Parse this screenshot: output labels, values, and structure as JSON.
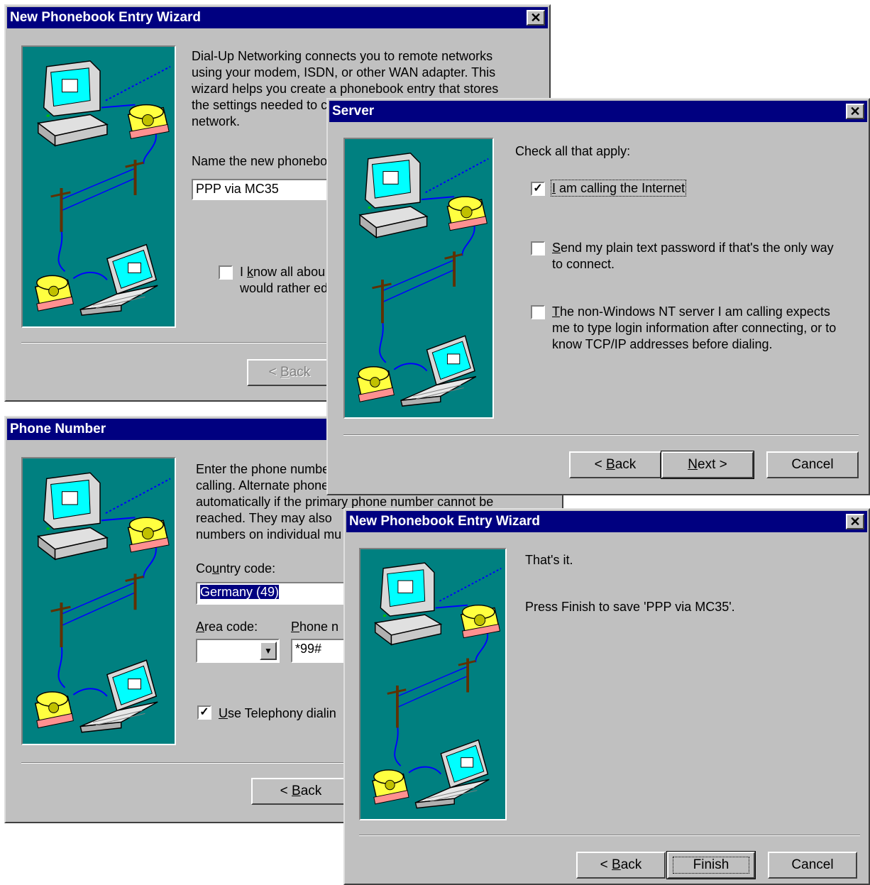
{
  "w1": {
    "title": "New Phonebook Entry Wizard",
    "intro": "Dial-Up Networking connects you to remote networks\nusing your modem, ISDN, or other WAN adapter.  This\nwizard helps you create a phonebook entry that stores\nthe settings needed to c\nnetwork.",
    "name_label": "Name the new phonebo",
    "name_value": "PPP via MC35",
    "know_pre": "I ",
    "know_u": "k",
    "know_post": "now all abou\nwould rather ed",
    "back_u": "B",
    "back_post": "ack",
    "back_pre": "< "
  },
  "w2": {
    "title": "Server",
    "check_label": "Check all that apply:",
    "opt1_u": "I",
    "opt1_rest": " am calling the Internet",
    "opt1_checked": true,
    "opt2_u": "S",
    "opt2_rest": "end my plain text password if that's the only way\nto connect.",
    "opt3_u": "T",
    "opt3_rest": "he non-Windows NT server I am calling expects\nme to type login information after connecting, or to\nknow TCP/IP addresses before dialing.",
    "back_pre": "< ",
    "back_u": "B",
    "back_post": "ack",
    "next_u": "N",
    "next_post": "ext >",
    "cancel": "Cancel"
  },
  "w3": {
    "title": "Phone Number",
    "intro": "Enter the phone number of the dial-up server you are\ncalling.  Alternate phone numbers, if any, are dialed\nautomatically if the primary phone number cannot be\nreached.  They may also\nnumbers on individual mu",
    "country_pre": "Co",
    "country_u": "u",
    "country_post": "ntry code:",
    "country_value": "Germany (49)",
    "area_pre": "",
    "area_u": "A",
    "area_post": "rea code:",
    "phone_u": "P",
    "phone_post": "hone n",
    "phone_value": "*99#",
    "telephony_u": "U",
    "telephony_post": "se Telephony dialin",
    "back_pre": "< ",
    "back_u": "B",
    "back_post": "ack"
  },
  "w4": {
    "title": "New Phonebook Entry Wizard",
    "line1": "That's it.",
    "line2": "Press Finish to save 'PPP via MC35'.",
    "back_pre": "< ",
    "back_u": "B",
    "back_post": "ack",
    "finish": "Finish",
    "cancel": "Cancel"
  },
  "icons": {
    "close": "close-icon",
    "check": "checkmark-icon",
    "dropdown": "chevron-down-icon",
    "illustration": "dialup-network-illustration"
  },
  "colors": {
    "titlebar": "#000080",
    "face": "#c0c0c0",
    "illustration_bg": "#008080"
  }
}
